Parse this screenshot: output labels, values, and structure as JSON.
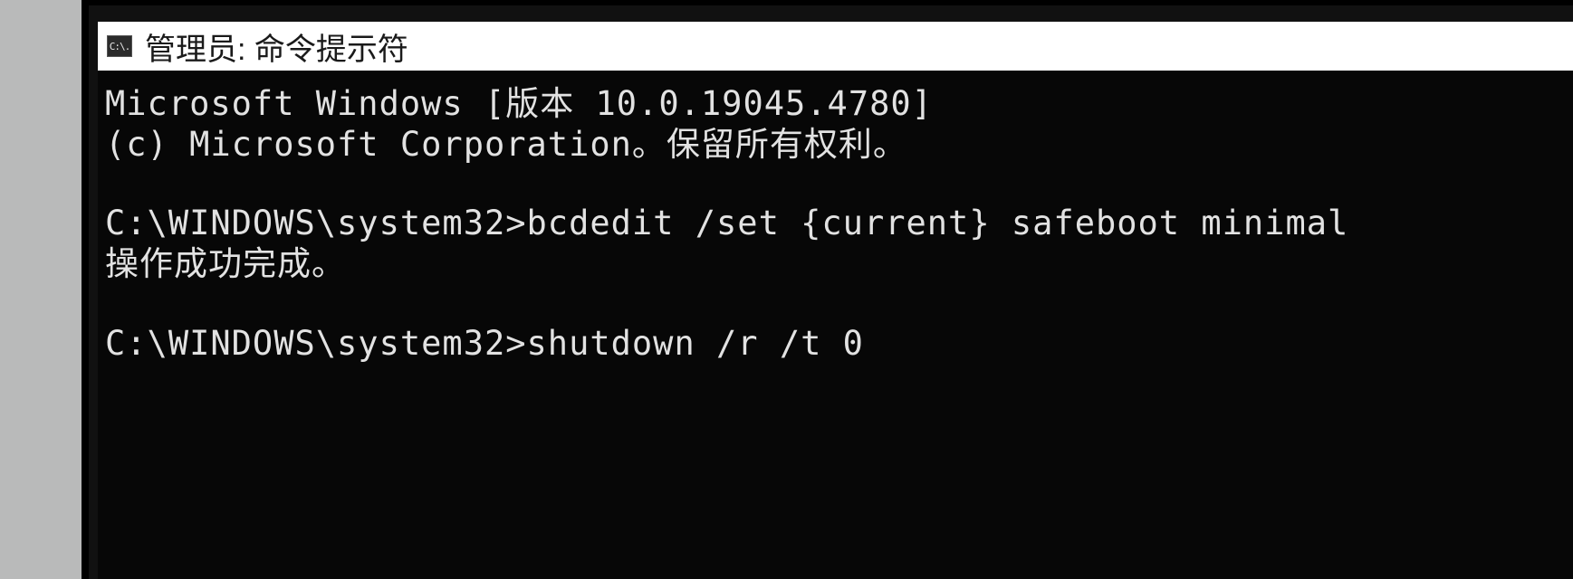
{
  "titlebar": {
    "icon_label": "C:\\.",
    "title": "管理员: 命令提示符"
  },
  "terminal": {
    "banner": {
      "line1": "Microsoft Windows [版本 10.0.19045.4780]",
      "line2": "(c) Microsoft Corporation。保留所有权利。"
    },
    "block1": {
      "prompt": "C:\\WINDOWS\\system32>",
      "command": "bcdedit /set {current} safeboot minimal",
      "result": "操作成功完成。"
    },
    "block2": {
      "prompt": "C:\\WINDOWS\\system32>",
      "command": "shutdown /r /t 0"
    }
  }
}
